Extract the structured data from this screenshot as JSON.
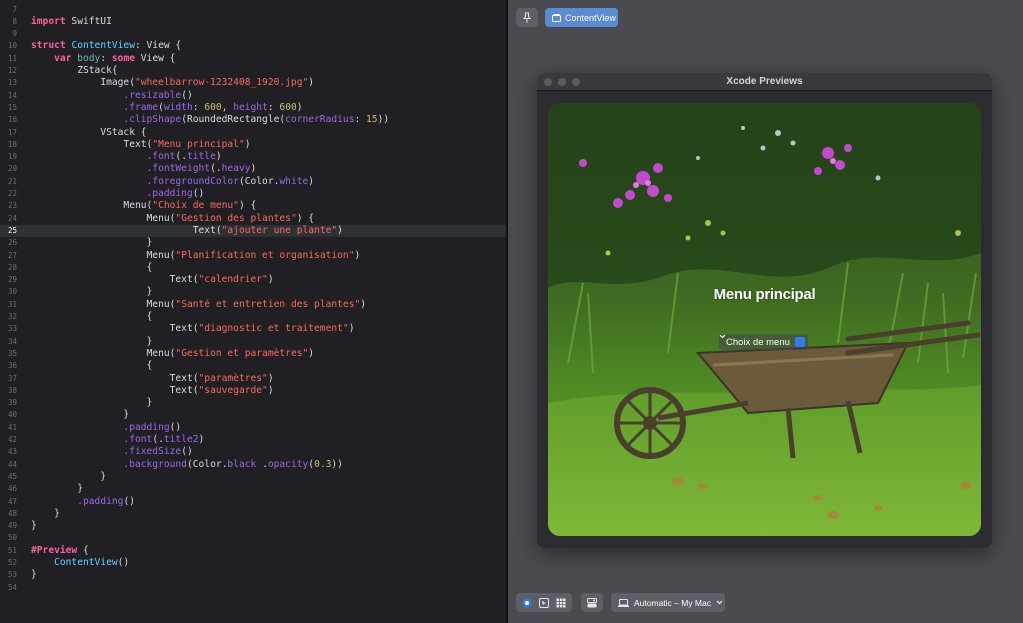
{
  "editor": {
    "lines": [
      {
        "n": "7",
        "indent": "",
        "tokens": []
      },
      {
        "n": "8",
        "indent": "",
        "tokens": [
          {
            "t": "import",
            "c": "kw"
          },
          {
            "t": " SwiftUI",
            "c": "pl"
          }
        ]
      },
      {
        "n": "9",
        "indent": "",
        "tokens": []
      },
      {
        "n": "10",
        "indent": "",
        "tokens": [
          {
            "t": "struct",
            "c": "kw"
          },
          {
            "t": " ",
            "c": "pl"
          },
          {
            "t": "ContentView",
            "c": "ty"
          },
          {
            "t": ": View {",
            "c": "pl"
          }
        ]
      },
      {
        "n": "11",
        "indent": "    ",
        "tokens": [
          {
            "t": "var",
            "c": "kw"
          },
          {
            "t": " ",
            "c": "pl"
          },
          {
            "t": "body",
            "c": "fn"
          },
          {
            "t": ": ",
            "c": "pl"
          },
          {
            "t": "some",
            "c": "kw"
          },
          {
            "t": " View {",
            "c": "pl"
          }
        ]
      },
      {
        "n": "12",
        "indent": "        ",
        "tokens": [
          {
            "t": "ZStack{",
            "c": "pl"
          }
        ]
      },
      {
        "n": "13",
        "indent": "            ",
        "tokens": [
          {
            "t": "Image(",
            "c": "pl"
          },
          {
            "t": "\"wheelbarrow-1232408_1920.jpg\"",
            "c": "st"
          },
          {
            "t": ")",
            "c": "pl"
          }
        ]
      },
      {
        "n": "14",
        "indent": "                ",
        "tokens": [
          {
            "t": ".resizable",
            "c": "mc"
          },
          {
            "t": "()",
            "c": "pl"
          }
        ]
      },
      {
        "n": "15",
        "indent": "                ",
        "tokens": [
          {
            "t": ".frame",
            "c": "mc"
          },
          {
            "t": "(",
            "c": "pl"
          },
          {
            "t": "width",
            "c": "mc"
          },
          {
            "t": ": ",
            "c": "pl"
          },
          {
            "t": "600",
            "c": "nm"
          },
          {
            "t": ", ",
            "c": "pl"
          },
          {
            "t": "height",
            "c": "mc"
          },
          {
            "t": ": ",
            "c": "pl"
          },
          {
            "t": "600",
            "c": "nm"
          },
          {
            "t": ")",
            "c": "pl"
          }
        ]
      },
      {
        "n": "16",
        "indent": "                ",
        "tokens": [
          {
            "t": ".clipShape",
            "c": "mc"
          },
          {
            "t": "(RoundedRectangle(",
            "c": "pl"
          },
          {
            "t": "cornerRadius",
            "c": "mc"
          },
          {
            "t": ": ",
            "c": "pl"
          },
          {
            "t": "15",
            "c": "nm"
          },
          {
            "t": "))",
            "c": "pl"
          }
        ]
      },
      {
        "n": "17",
        "indent": "            ",
        "tokens": [
          {
            "t": "VStack {",
            "c": "pl"
          }
        ]
      },
      {
        "n": "18",
        "indent": "                ",
        "tokens": [
          {
            "t": "Text(",
            "c": "pl"
          },
          {
            "t": "\"Menu principal\"",
            "c": "st"
          },
          {
            "t": ")",
            "c": "pl"
          }
        ]
      },
      {
        "n": "19",
        "indent": "                    ",
        "tokens": [
          {
            "t": ".font",
            "c": "mc"
          },
          {
            "t": "(.",
            "c": "pl"
          },
          {
            "t": "title",
            "c": "mc"
          },
          {
            "t": ")",
            "c": "pl"
          }
        ]
      },
      {
        "n": "20",
        "indent": "                    ",
        "tokens": [
          {
            "t": ".fontWeight",
            "c": "mc"
          },
          {
            "t": "(.",
            "c": "pl"
          },
          {
            "t": "heavy",
            "c": "mc"
          },
          {
            "t": ")",
            "c": "pl"
          }
        ]
      },
      {
        "n": "21",
        "indent": "                    ",
        "tokens": [
          {
            "t": ".foregroundColor",
            "c": "mc"
          },
          {
            "t": "(Color.",
            "c": "pl"
          },
          {
            "t": "white",
            "c": "mc"
          },
          {
            "t": ")",
            "c": "pl"
          }
        ]
      },
      {
        "n": "22",
        "indent": "                    ",
        "tokens": [
          {
            "t": ".padding",
            "c": "mc"
          },
          {
            "t": "()",
            "c": "pl"
          }
        ]
      },
      {
        "n": "23",
        "indent": "                ",
        "tokens": [
          {
            "t": "Menu(",
            "c": "pl"
          },
          {
            "t": "\"Choix de menu\"",
            "c": "st"
          },
          {
            "t": ") {",
            "c": "pl"
          }
        ]
      },
      {
        "n": "24",
        "indent": "                    ",
        "tokens": [
          {
            "t": "Menu(",
            "c": "pl"
          },
          {
            "t": "\"Gestion des plantes\"",
            "c": "st"
          },
          {
            "t": ") {",
            "c": "pl"
          }
        ]
      },
      {
        "n": "25",
        "indent": "                            ",
        "tokens": [
          {
            "t": "Text(",
            "c": "pl"
          },
          {
            "t": "\"ajouter une plante\"",
            "c": "st"
          },
          {
            "t": ")",
            "c": "pl"
          }
        ],
        "active": true
      },
      {
        "n": "26",
        "indent": "                    ",
        "tokens": [
          {
            "t": "}",
            "c": "pl"
          }
        ]
      },
      {
        "n": "27",
        "indent": "                    ",
        "tokens": [
          {
            "t": "Menu(",
            "c": "pl"
          },
          {
            "t": "\"Planification et organisation\"",
            "c": "st"
          },
          {
            "t": ")",
            "c": "pl"
          }
        ]
      },
      {
        "n": "28",
        "indent": "                    ",
        "tokens": [
          {
            "t": "{",
            "c": "pl"
          }
        ]
      },
      {
        "n": "29",
        "indent": "                        ",
        "tokens": [
          {
            "t": "Text(",
            "c": "pl"
          },
          {
            "t": "\"calendrier\"",
            "c": "st"
          },
          {
            "t": ")",
            "c": "pl"
          }
        ]
      },
      {
        "n": "30",
        "indent": "                    ",
        "tokens": [
          {
            "t": "}",
            "c": "pl"
          }
        ]
      },
      {
        "n": "31",
        "indent": "                    ",
        "tokens": [
          {
            "t": "Menu(",
            "c": "pl"
          },
          {
            "t": "\"Santé et entretien des plantes\"",
            "c": "st"
          },
          {
            "t": ")",
            "c": "pl"
          }
        ]
      },
      {
        "n": "32",
        "indent": "                    ",
        "tokens": [
          {
            "t": "{",
            "c": "pl"
          }
        ]
      },
      {
        "n": "33",
        "indent": "                        ",
        "tokens": [
          {
            "t": "Text(",
            "c": "pl"
          },
          {
            "t": "\"diagnostic et traitement\"",
            "c": "st"
          },
          {
            "t": ")",
            "c": "pl"
          }
        ]
      },
      {
        "n": "34",
        "indent": "                    ",
        "tokens": [
          {
            "t": "}",
            "c": "pl"
          }
        ]
      },
      {
        "n": "35",
        "indent": "                    ",
        "tokens": [
          {
            "t": "Menu(",
            "c": "pl"
          },
          {
            "t": "\"Gestion et paramètres\"",
            "c": "st"
          },
          {
            "t": ")",
            "c": "pl"
          }
        ]
      },
      {
        "n": "36",
        "indent": "                    ",
        "tokens": [
          {
            "t": "{",
            "c": "pl"
          }
        ]
      },
      {
        "n": "37",
        "indent": "                        ",
        "tokens": [
          {
            "t": "Text(",
            "c": "pl"
          },
          {
            "t": "\"paramètres\"",
            "c": "st"
          },
          {
            "t": ")",
            "c": "pl"
          }
        ]
      },
      {
        "n": "38",
        "indent": "                        ",
        "tokens": [
          {
            "t": "Text(",
            "c": "pl"
          },
          {
            "t": "\"sauvegarde\"",
            "c": "st"
          },
          {
            "t": ")",
            "c": "pl"
          }
        ]
      },
      {
        "n": "39",
        "indent": "                    ",
        "tokens": [
          {
            "t": "}",
            "c": "pl"
          }
        ]
      },
      {
        "n": "40",
        "indent": "                ",
        "tokens": [
          {
            "t": "}",
            "c": "pl"
          }
        ]
      },
      {
        "n": "41",
        "indent": "                ",
        "tokens": [
          {
            "t": ".padding",
            "c": "mc"
          },
          {
            "t": "()",
            "c": "pl"
          }
        ]
      },
      {
        "n": "42",
        "indent": "                ",
        "tokens": [
          {
            "t": ".font",
            "c": "mc"
          },
          {
            "t": "(.",
            "c": "pl"
          },
          {
            "t": "title2",
            "c": "mc"
          },
          {
            "t": ")",
            "c": "pl"
          }
        ]
      },
      {
        "n": "43",
        "indent": "                ",
        "tokens": [
          {
            "t": ".fixedSize",
            "c": "mc"
          },
          {
            "t": "()",
            "c": "pl"
          }
        ]
      },
      {
        "n": "44",
        "indent": "                ",
        "tokens": [
          {
            "t": ".background",
            "c": "mc"
          },
          {
            "t": "(Color.",
            "c": "pl"
          },
          {
            "t": "black",
            "c": "mc"
          },
          {
            "t": " .",
            "c": "pl"
          },
          {
            "t": "opacity",
            "c": "mc"
          },
          {
            "t": "(",
            "c": "pl"
          },
          {
            "t": "0.3",
            "c": "nm"
          },
          {
            "t": "))",
            "c": "pl"
          }
        ]
      },
      {
        "n": "45",
        "indent": "            ",
        "tokens": [
          {
            "t": "}",
            "c": "pl"
          }
        ]
      },
      {
        "n": "46",
        "indent": "        ",
        "tokens": [
          {
            "t": "}",
            "c": "pl"
          }
        ]
      },
      {
        "n": "47",
        "indent": "        ",
        "tokens": [
          {
            "t": ".padding",
            "c": "mc"
          },
          {
            "t": "()",
            "c": "pl"
          }
        ]
      },
      {
        "n": "48",
        "indent": "    ",
        "tokens": [
          {
            "t": "}",
            "c": "pl"
          }
        ]
      },
      {
        "n": "49",
        "indent": "",
        "tokens": [
          {
            "t": "}",
            "c": "pl"
          }
        ]
      },
      {
        "n": "50",
        "indent": "",
        "tokens": []
      },
      {
        "n": "51",
        "indent": "",
        "tokens": [
          {
            "t": "#Preview",
            "c": "kw"
          },
          {
            "t": " {",
            "c": "pl"
          }
        ]
      },
      {
        "n": "52",
        "indent": "    ",
        "tokens": [
          {
            "t": "ContentView",
            "c": "ty"
          },
          {
            "t": "()",
            "c": "pl"
          }
        ]
      },
      {
        "n": "53",
        "indent": "",
        "tokens": [
          {
            "t": "}",
            "c": "pl"
          }
        ]
      },
      {
        "n": "54",
        "indent": "",
        "tokens": []
      }
    ]
  },
  "canvas": {
    "pin_icon": "pin-icon",
    "selected_view": "ContentView",
    "window_title": "Xcode Previews",
    "preview": {
      "menu_title": "Menu principal",
      "menu_button": "Choix de menu",
      "image_name": "wheelbarrow-1232408_1920.jpg"
    },
    "bottom_bar": {
      "mode_icons": [
        "live-mode-icon",
        "selectable-mode-icon",
        "variants-icon"
      ],
      "device_settings_icon": "device-settings-icon",
      "device_label": "Automatic – My Mac"
    },
    "colors": {
      "accent": "#2f7bf5",
      "chip": "#5a8bd0",
      "canvas_bg": "#4a4b51",
      "editor_bg": "#1f1f24"
    }
  }
}
